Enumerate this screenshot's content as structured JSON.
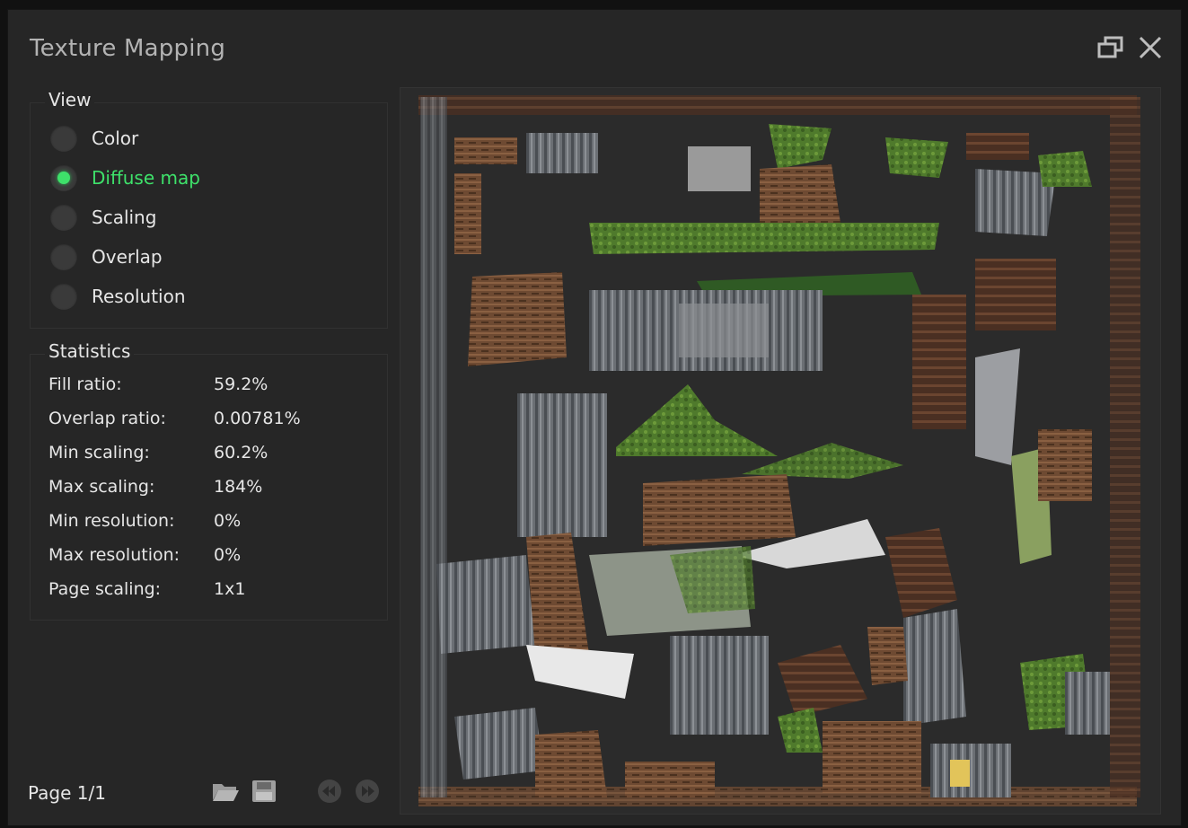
{
  "window": {
    "title": "Texture Mapping"
  },
  "view": {
    "title": "View",
    "options": [
      {
        "label": "Color",
        "selected": false
      },
      {
        "label": "Diffuse map",
        "selected": true
      },
      {
        "label": "Scaling",
        "selected": false
      },
      {
        "label": "Overlap",
        "selected": false
      },
      {
        "label": "Resolution",
        "selected": false
      }
    ]
  },
  "statistics": {
    "title": "Statistics",
    "rows": [
      {
        "label": "Fill ratio:",
        "value": "59.2%"
      },
      {
        "label": "Overlap ratio:",
        "value": "0.00781%"
      },
      {
        "label": "Min scaling:",
        "value": "60.2%"
      },
      {
        "label": "Max scaling:",
        "value": "184%"
      },
      {
        "label": "Min resolution:",
        "value": "0%"
      },
      {
        "label": "Max resolution:",
        "value": "0%"
      },
      {
        "label": "Page scaling:",
        "value": "1x1"
      }
    ]
  },
  "footer": {
    "page_label": "Page 1/1"
  },
  "icons": {
    "restore": "restore-window-icon",
    "close": "close-icon",
    "open": "folder-open-icon",
    "save": "save-icon",
    "prev": "previous-page-icon",
    "next": "next-page-icon"
  },
  "colors": {
    "accent": "#3ee16a",
    "background": "#262626",
    "text": "#e6e6e6"
  }
}
